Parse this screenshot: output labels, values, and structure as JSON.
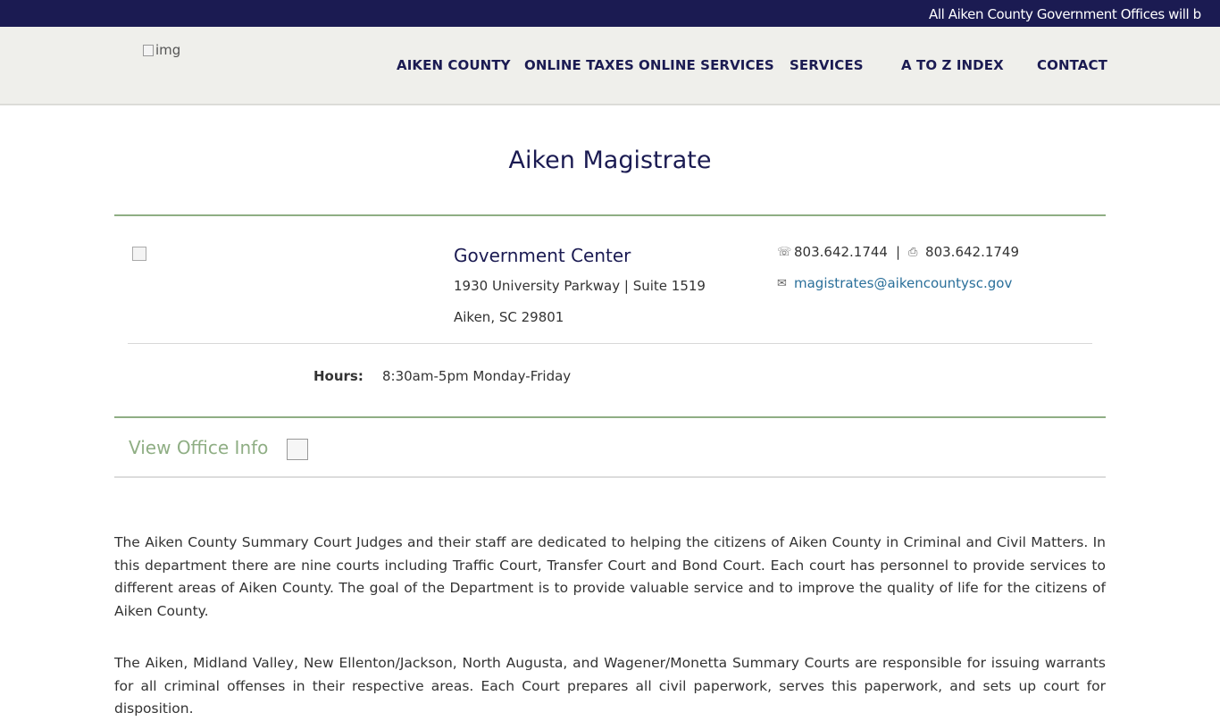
{
  "ticker": {
    "text": "All Aiken County Government Offices will b"
  },
  "header": {
    "logo_alt": "img",
    "nav": [
      {
        "label": "AIKEN COUNTY"
      },
      {
        "label": "ONLINE TAXES"
      },
      {
        "label": "ONLINE SERVICES"
      },
      {
        "label": "SERVICES"
      },
      {
        "label": "A TO Z INDEX"
      },
      {
        "label": "CONTACT"
      }
    ]
  },
  "page": {
    "title": "Aiken Magistrate"
  },
  "office": {
    "location_name": "Government Center",
    "address_line1": "1930 University Parkway | Suite 1519",
    "address_line2": "Aiken, SC 29801",
    "phone": "803.642.1744",
    "fax": "803.642.1749",
    "email": "magistrates@aikencountysc.gov",
    "hours_label": "Hours:",
    "hours_value": "8:30am-5pm Monday-Friday",
    "view_info_label": "View Office Info"
  },
  "content": {
    "paragraph1": "The Aiken County Summary Court Judges and their staff are dedicated to helping the citizens of Aiken County in Criminal and Civil Matters. In this department there are nine courts including Traffic Court, Transfer Court and Bond Court. Each court has personnel to provide services to different areas of Aiken County. The goal of the Department is to provide valuable service and to improve the quality of life for the citizens of Aiken County.",
    "paragraph2": "The Aiken, Midland Valley, New Ellenton/Jackson, North Augusta, and Wagener/Monetta Summary Courts are responsible for issuing warrants for all criminal offenses in their respective areas. Each Court prepares all civil paperwork, serves this paperwork, and sets up court for disposition."
  },
  "colors": {
    "brand_navy": "#1b1b52",
    "accent_green": "#8fae84",
    "link_blue": "#2a6f9a"
  },
  "icons": {
    "phone": "phone-icon",
    "fax": "fax-icon",
    "email": "envelope-icon"
  }
}
